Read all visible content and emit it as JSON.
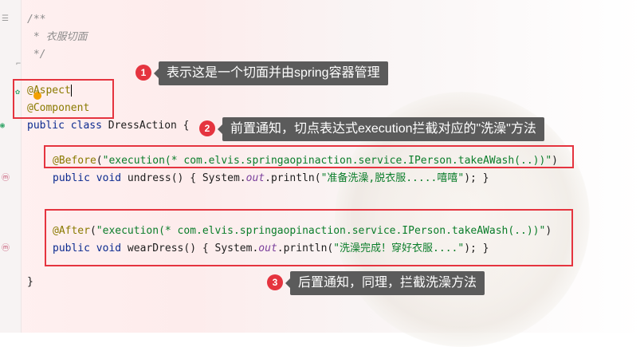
{
  "editor": {
    "lines": {
      "doc_open": "/**",
      "doc_text": " * 衣服切面",
      "doc_close": " */",
      "aspect_annotation": "@Aspect",
      "component_annotation": "@Component",
      "class_kw": "public class ",
      "class_name": "DressAction {",
      "before_annotation": "@Before",
      "before_paren_open": "(",
      "before_expr": "\"execution(* com.elvis.springaopinaction.service.IPerson.takeAWash(..))\"",
      "before_paren_close": ")",
      "undress_kw": "public void ",
      "undress_sig": "undress() { System.",
      "out1": "out",
      "println1": ".println(",
      "undress_str": "\"准备洗澡,脱衣服.....嘻嘻\"",
      "undress_end": "); }",
      "after_annotation": "@After",
      "after_paren_open": "(",
      "after_expr": "\"execution(* com.elvis.springaopinaction.service.IPerson.takeAWash(..))\"",
      "after_paren_close": ")",
      "wear_kw": "public void ",
      "wear_sig": "wearDress() { System.",
      "out2": "out",
      "println2": ".println(",
      "wear_str": "\"洗澡完成！穿好衣服....\"",
      "wear_end": "); }",
      "class_close": "}"
    }
  },
  "annotations": [
    {
      "number": "1",
      "text": "表示这是一个切面并由spring容器管理"
    },
    {
      "number": "2",
      "text": "前置通知，切点表达式execution拦截对应的\"洗澡\"方法"
    },
    {
      "number": "3",
      "text": "后置通知，同理，拦截洗澡方法"
    }
  ],
  "colors": {
    "highlight_box": "#e5343f",
    "tooltip_bg": "#5b5b5b",
    "badge_bg": "#e5343f"
  }
}
